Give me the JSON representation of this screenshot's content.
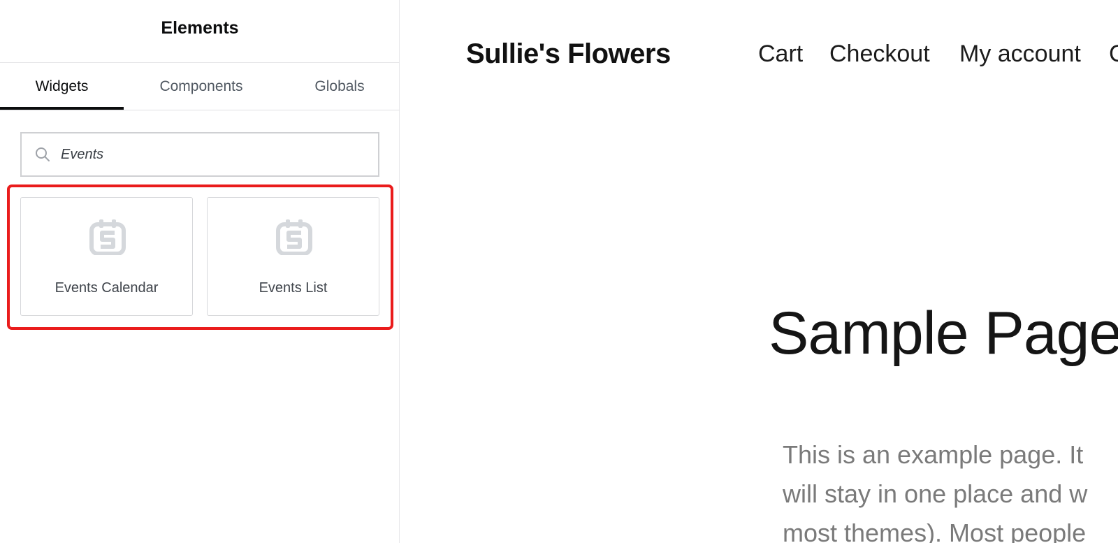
{
  "panel": {
    "title": "Elements",
    "tabs": [
      {
        "label": "Widgets",
        "active": true
      },
      {
        "label": "Components",
        "active": false
      },
      {
        "label": "Globals",
        "active": false
      }
    ],
    "search": {
      "value": "Events",
      "icon": "search-icon"
    },
    "widgets": [
      {
        "label": "Events Calendar",
        "icon": "calendar-icon"
      },
      {
        "label": "Events List",
        "icon": "calendar-icon"
      }
    ],
    "highlight_color": "#ea1c1c"
  },
  "site": {
    "title": "Sullie's Flowers",
    "nav": [
      "Cart",
      "Checkout",
      "My account",
      "C"
    ],
    "heading": "Sample Page",
    "body_lines": [
      "This is an example page. It",
      "will stay in one place and w",
      "most themes). Most people"
    ]
  }
}
